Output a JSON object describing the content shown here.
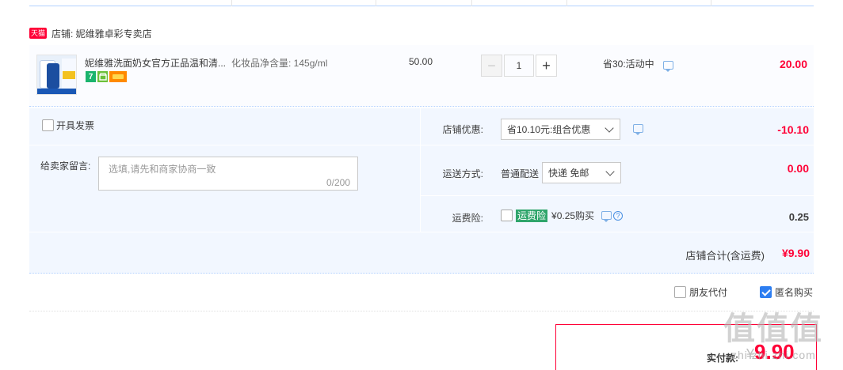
{
  "shop": {
    "badge": "天猫",
    "name": "店铺: 妮维雅卓彩专卖店"
  },
  "item": {
    "title": "妮维雅洗面奶女官方正品温和清...",
    "sku": "化妆品净含量: 145g/ml",
    "price": "50.00",
    "quantity": "1",
    "minus_label": "−",
    "plus_label": "+",
    "promo": "省30:活动中",
    "total": "20.00",
    "badges": [
      "7",
      "store",
      "card"
    ]
  },
  "options": {
    "invoice_label": "开具发票",
    "message_label": "给卖家留言:",
    "message_placeholder": "选填,请先和商家协商一致",
    "message_count": "0/200",
    "shop_discount_label": "店铺优惠:",
    "shop_discount_value": "省10.10元:组合优惠",
    "shop_discount_amount": "-10.10",
    "shipping_label": "运送方式:",
    "shipping_type": "普通配送",
    "shipping_value": "快递 免邮",
    "shipping_amount": "0.00",
    "insurance_label": "运费险:",
    "insurance_tag": "运费险",
    "insurance_text": "¥0.25购买",
    "insurance_amount": "0.25"
  },
  "summary": {
    "label": "店铺合计(含运费)",
    "value": "¥9.90"
  },
  "extra": {
    "friend_pay_label": "朋友代付",
    "anonymous_label": "匿名购买"
  },
  "payment": {
    "label": "实付款:",
    "currency": "¥",
    "amount": "9.90"
  },
  "watermark": {
    "big": "值值值",
    "small": "zhi zhi zhi.com"
  },
  "colors": {
    "accent_red": "#ff0036",
    "brand_blue": "#2d7ef1",
    "row_bg": "#f2f7ff"
  }
}
